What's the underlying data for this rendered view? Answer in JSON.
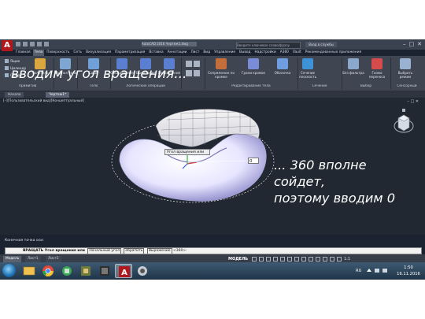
{
  "app": {
    "logo_letter": "A",
    "document_title": "AutoCAD 2016 Чертеж1.dwg",
    "search_placeholder": "Введите ключевое слово/фразу",
    "user_label": "Вход в службы",
    "window_controls": [
      "–",
      "□",
      "✕"
    ]
  },
  "menu": {
    "items": [
      "Главная",
      "Тело",
      "Поверхность",
      "Сеть",
      "Визуализация",
      "Параметризация",
      "Вставка",
      "Аннотации",
      "Лист",
      "Вид",
      "Управление",
      "Вывод",
      "Надстройки",
      "A360",
      "Vault",
      "Рекомендованные приложения"
    ],
    "active_index": 1
  },
  "ribbon": {
    "primitives": {
      "label": "Примитив",
      "items": [
        "Ящик",
        "Цилиндр",
        "Сфера"
      ],
      "buttons": [
        "Политело",
        "Журнал тела"
      ]
    },
    "solid": {
      "label": "Тело",
      "buttons": [
        "Сдвиг",
        "Вытянуть"
      ]
    },
    "boolean": {
      "label": "Логические операции",
      "buttons": [
        "Объединение",
        "Вычитание",
        "Пересечение"
      ]
    },
    "edit": {
      "label": "Редактирование тела",
      "buttons": [
        "Сопряжение по кромке",
        "Грани кромок",
        "Оболочка"
      ]
    },
    "section": {
      "label": "Сечение",
      "buttons": [
        "Сечение плоскость",
        "Без фильтра"
      ]
    },
    "selection": {
      "label": "Выбор",
      "buttons": [
        "Гизмо переноса",
        "Выбрать режим"
      ]
    },
    "gizmo_label": "Сенсорный"
  },
  "tabs": {
    "items": [
      "Начало",
      "Чертеж1*"
    ],
    "active_index": 1
  },
  "viewport": {
    "label": "[–][Пользовательский вид][Концептуальный]",
    "controls": "– □ ✕",
    "cube_label": "Ю"
  },
  "overlay": {
    "title": "вводим угол вращения...",
    "note_lines": [
      "... 360 вполне",
      "сойдет,",
      "поэтому вводим 0"
    ]
  },
  "tooltip": {
    "text": "Угол вращения или"
  },
  "dynamic_input": {
    "value": "0"
  },
  "command": {
    "history": "Конечная точка оси:",
    "prefix": "ВРАЩАТЬ Угол вращения или",
    "options": [
      "Начальный угол",
      "обратить",
      "Выражение"
    ],
    "suffix": "<360>:"
  },
  "layout": {
    "tabs": [
      "Модель",
      "Лист1",
      "Лист2"
    ],
    "active_index": 0,
    "model_button": "МОДЕЛЬ",
    "scale": "1:1"
  },
  "taskbar": {
    "language": "RU",
    "time": "1:50",
    "date": "16.11.2016",
    "apps": [
      "explorer",
      "chrome",
      "file-manager",
      "media",
      "autocad",
      "other"
    ],
    "active_index": 4
  },
  "colors": {
    "accent": "#b0181d",
    "viewport_bg": "#212831",
    "ribbon_bg": "#3f4652",
    "overlay_text": "#ffffff",
    "model_solid": "#e8e6ff",
    "grid_mesh": "#eeeeee"
  }
}
